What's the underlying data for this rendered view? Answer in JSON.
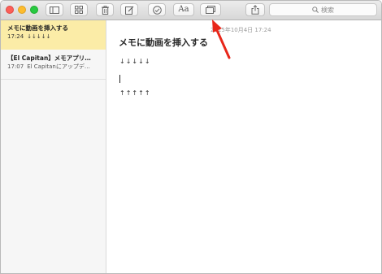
{
  "window": {
    "traffic_lights": [
      "close",
      "minimize",
      "zoom"
    ]
  },
  "toolbar": {
    "buttons": [
      {
        "name": "sidebar-toggle-button",
        "icon": "sidebar-icon"
      },
      {
        "name": "attachments-browser-button",
        "icon": "grid-icon"
      },
      {
        "name": "delete-button",
        "icon": "trash-icon"
      },
      {
        "name": "new-note-button",
        "icon": "compose-icon"
      },
      {
        "name": "checklist-button",
        "icon": "checkmark-circle-icon"
      },
      {
        "name": "format-button",
        "icon": "text-format-icon",
        "label": "Aa"
      },
      {
        "name": "insert-media-button",
        "icon": "photo-browser-icon"
      },
      {
        "name": "share-button",
        "icon": "share-icon"
      }
    ],
    "search_placeholder": "検索"
  },
  "notes_list": [
    {
      "title": "メモに動画を挿入する",
      "time": "17:24",
      "preview": "↓↓↓↓↓",
      "selected": true
    },
    {
      "title": "【El Capitan】メモアプリ…",
      "time": "17:07",
      "preview": "El Capitanにアップデ…",
      "selected": false
    }
  ],
  "editor": {
    "date": "2015年10月4日 17:24",
    "title": "メモに動画を挿入する",
    "line1": "↓↓↓↓↓",
    "line2": "↑↑↑↑↑"
  },
  "colors": {
    "selection": "#fbeca7",
    "annotation_arrow": "#e8271a"
  }
}
